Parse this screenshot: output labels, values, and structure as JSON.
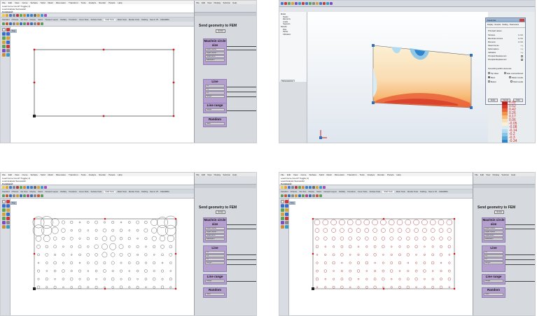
{
  "gh": {
    "menu": [
      "File",
      "Edit",
      "View",
      "Display",
      "Solution",
      "Help"
    ],
    "send_geometry_title": "Send geometry to FEM",
    "send_geometry_toggle": "Update",
    "maxmin_title": "Max/min circle size",
    "maxmin_sliders": [
      "Lower bound",
      "Upper bound",
      "Scale factor",
      "Resolution"
    ],
    "line_title": "Line",
    "line_sliders": [
      "Cx",
      "Cy",
      "Cz",
      "Length"
    ],
    "line_range_title": "Line range",
    "line_range_slider": "Range",
    "random_title": "Random",
    "random_slider": "Seed"
  },
  "rhino": {
    "menu": [
      "File",
      "Edit",
      "View",
      "Curve",
      "Surface",
      "Solid",
      "Mesh",
      "Dimension",
      "Transform",
      "Tools",
      "Analyze",
      "Render",
      "Panels",
      "Help"
    ],
    "cmd_lines": [
      "Load Curve Count? Toggle( 4)",
      "Load Analysis Successful",
      "Command:"
    ],
    "tabs": [
      "Standard",
      "CPlanes",
      "Set View",
      "Display",
      "Select",
      "Viewport Layout",
      "Visibility",
      "Transform",
      "Curve Tools",
      "Surface Tools",
      "Solid Tools",
      "Mesh Tools",
      "Render Tools",
      "Drafting",
      "New in V5",
      "KARAMBA"
    ],
    "active_tab": "Solid Tools",
    "viewport_label": "Top"
  },
  "analysis": {
    "tree": [
      "Model",
      "Nodes",
      "Elements",
      "Loads",
      "Supports",
      "Results",
      "Disp",
      "Stress",
      "Utilization"
    ],
    "panel_tab": "Dimensioning",
    "dialog_title": "Karamba",
    "dialog_tabs": [
      "Display",
      "Results",
      "Scaling",
      "Parameters"
    ],
    "dialog_head": "Principal values",
    "dialog_rows": [
      {
        "label": "Stresses",
        "value": "1  2  12"
      },
      {
        "label": "Membrane Forces",
        "value": "1  2  12"
      },
      {
        "label": "Moments",
        "value": "1  2  12"
      },
      {
        "label": "Shear Forces",
        "value": "x  y"
      },
      {
        "label": "Deformations",
        "value": "x  y"
      },
      {
        "label": "Utilization",
        "value": "x  y"
      },
      {
        "label": "Principal Displacement",
        "value": ""
      },
      {
        "label": "Principal Displacement",
        "value": ""
      }
    ],
    "dialog_section": "Smoothing within elements",
    "dialog_opts": [
      "Top Value",
      "Mean",
      "Bottom",
      "Hide unsmoothened",
      "Flatten results",
      "Shell results"
    ],
    "dialog_buttons": [
      "Apply",
      "Cancel",
      "Help"
    ],
    "legend": {
      "values": [
        "0.62",
        "0.52",
        "0.42",
        "0.26",
        "0.17",
        "0.06",
        "-0.05",
        "-0.08",
        "-0.14",
        "-0.2",
        "-0.3",
        "-0.34",
        "-0.38"
      ],
      "colors": [
        "#c01d1d",
        "#d63a2a",
        "#e96238",
        "#f3924c",
        "#f8bd7a",
        "#fadcb2",
        "#fbf0d4",
        "#d8ecf4",
        "#b3dbef",
        "#86c4e8",
        "#54a8dc",
        "#2f84cb",
        "#1a5fb4"
      ],
      "unit": "σ1 (kPa)",
      "case": "Cases: 1"
    }
  }
}
